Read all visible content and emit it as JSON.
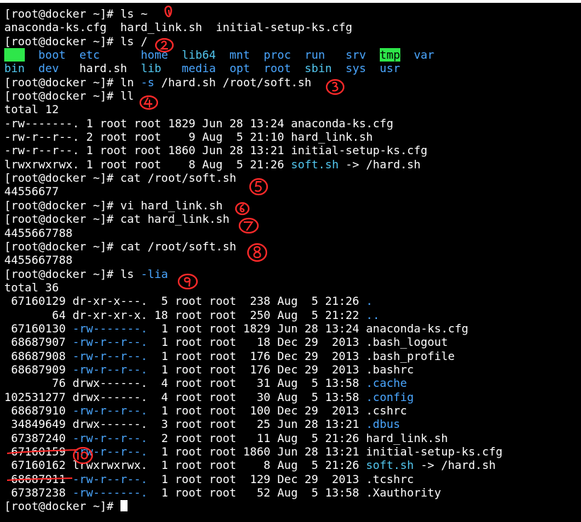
{
  "colors": {
    "fg": "#ffffff",
    "dir": "#4aa6ff",
    "link": "#52c6ee",
    "exe": "#2ee64a",
    "mark": "#ff2a2a"
  },
  "lines": [
    [
      {
        "t": "[root@docker ~]# ls ~",
        "c": "fg"
      }
    ],
    [
      {
        "t": "anaconda-ks.cfg  hard_link.sh  initial-setup-ks.cfg",
        "c": "fg"
      }
    ],
    [
      {
        "t": "[root@docker ~]# ls /",
        "c": "fg"
      }
    ],
    [
      {
        "t": "bin",
        "c": "hl-bin"
      },
      {
        "t": "  ",
        "c": "fg"
      },
      {
        "t": "boot",
        "c": "dir"
      },
      {
        "t": "  ",
        "c": "fg"
      },
      {
        "t": "etc",
        "c": "dir"
      },
      {
        "t": "      ",
        "c": "fg"
      },
      {
        "t": "home",
        "c": "dir"
      },
      {
        "t": "  ",
        "c": "fg"
      },
      {
        "t": "lib64",
        "c": "link"
      },
      {
        "t": "  ",
        "c": "fg"
      },
      {
        "t": "mnt",
        "c": "dir"
      },
      {
        "t": "  ",
        "c": "fg"
      },
      {
        "t": "proc",
        "c": "dir"
      },
      {
        "t": "  ",
        "c": "fg"
      },
      {
        "t": "run",
        "c": "dir"
      },
      {
        "t": "   ",
        "c": "fg"
      },
      {
        "t": "srv",
        "c": "dir"
      },
      {
        "t": "  ",
        "c": "fg"
      },
      {
        "t": "tmp",
        "c": "hl-tmp"
      },
      {
        "t": "  ",
        "c": "fg"
      },
      {
        "t": "var",
        "c": "dir"
      }
    ],
    [
      {
        "t": "bin",
        "c": "link"
      },
      {
        "t": "  ",
        "c": "fg"
      },
      {
        "t": "dev",
        "c": "dir"
      },
      {
        "t": "   ",
        "c": "fg"
      },
      {
        "t": "hard.sh",
        "c": "fg"
      },
      {
        "t": "  ",
        "c": "fg"
      },
      {
        "t": "lib",
        "c": "link"
      },
      {
        "t": "   ",
        "c": "fg"
      },
      {
        "t": "media",
        "c": "dir"
      },
      {
        "t": "  ",
        "c": "fg"
      },
      {
        "t": "opt",
        "c": "dir"
      },
      {
        "t": "  ",
        "c": "fg"
      },
      {
        "t": "root",
        "c": "dir"
      },
      {
        "t": "  ",
        "c": "fg"
      },
      {
        "t": "sbin",
        "c": "link"
      },
      {
        "t": "  ",
        "c": "fg"
      },
      {
        "t": "sys",
        "c": "dir"
      },
      {
        "t": "  ",
        "c": "fg"
      },
      {
        "t": "usr",
        "c": "dir"
      }
    ],
    [
      {
        "t": "[root@docker ~]# ln ",
        "c": "fg"
      },
      {
        "t": "-s",
        "c": "dir"
      },
      {
        "t": " /hard.sh /root/soft.sh",
        "c": "fg"
      }
    ],
    [
      {
        "t": "[root@docker ~]# ll",
        "c": "fg"
      }
    ],
    [
      {
        "t": "total 12",
        "c": "fg"
      }
    ],
    [
      {
        "t": "-rw-------. 1 root root 1829 Jun 28 13:24 anaconda-ks.cfg",
        "c": "fg"
      }
    ],
    [
      {
        "t": "-rw-r--r--. 2 root root    9 Aug  5 21:10 hard_link.sh",
        "c": "fg"
      }
    ],
    [
      {
        "t": "-rw-r--r--. 1 root root 1860 Jun 28 13:21 initial-setup-ks.cfg",
        "c": "fg"
      }
    ],
    [
      {
        "t": "lrwxrwxrwx. 1 root root    8 Aug  5 21:26 ",
        "c": "fg"
      },
      {
        "t": "soft.sh",
        "c": "link"
      },
      {
        "t": " -> /hard.sh",
        "c": "fg"
      }
    ],
    [
      {
        "t": "[root@docker ~]# cat /root/soft.sh",
        "c": "fg"
      }
    ],
    [
      {
        "t": "44556677",
        "c": "fg"
      }
    ],
    [
      {
        "t": "[root@docker ~]# vi hard_link.sh",
        "c": "fg"
      }
    ],
    [
      {
        "t": "[root@docker ~]# cat hard_link.sh",
        "c": "fg"
      }
    ],
    [
      {
        "t": "4455667788",
        "c": "fg"
      }
    ],
    [
      {
        "t": "[root@docker ~]# cat /root/soft.sh",
        "c": "fg"
      }
    ],
    [
      {
        "t": "4455667788",
        "c": "fg"
      }
    ],
    [
      {
        "t": "[root@docker ~]# ls ",
        "c": "fg"
      },
      {
        "t": "-lia",
        "c": "dir"
      }
    ],
    [
      {
        "t": "total 36",
        "c": "fg"
      }
    ],
    [
      {
        "t": " 67160129 dr-xr-x---.  5 root root  238 Aug  5 21:26 ",
        "c": "fg"
      },
      {
        "t": ".",
        "c": "dir"
      }
    ],
    [
      {
        "t": "       64 dr-xr-xr-x. 18 root root  250 Aug  5 21:22 ",
        "c": "fg"
      },
      {
        "t": "..",
        "c": "dir"
      }
    ],
    [
      {
        "t": " 67160130 ",
        "c": "fg"
      },
      {
        "t": "-rw-------.",
        "c": "dir"
      },
      {
        "t": "  1 root root 1829 Jun 28 13:24 anaconda-ks.cfg",
        "c": "fg"
      }
    ],
    [
      {
        "t": " 68687907 ",
        "c": "fg"
      },
      {
        "t": "-rw-r--r--.",
        "c": "dir"
      },
      {
        "t": "  1 root root   18 Dec 29  2013 .bash_logout",
        "c": "fg"
      }
    ],
    [
      {
        "t": " 68687908 ",
        "c": "fg"
      },
      {
        "t": "-rw-r--r--.",
        "c": "dir"
      },
      {
        "t": "  1 root root  176 Dec 29  2013 .bash_profile",
        "c": "fg"
      }
    ],
    [
      {
        "t": " 68687909 ",
        "c": "fg"
      },
      {
        "t": "-rw-r--r--.",
        "c": "dir"
      },
      {
        "t": "  1 root root  176 Dec 29  2013 .bashrc",
        "c": "fg"
      }
    ],
    [
      {
        "t": "       76 drwx------.  4 root root   31 Aug  5 13:58 ",
        "c": "fg"
      },
      {
        "t": ".cache",
        "c": "dir"
      }
    ],
    [
      {
        "t": "102531277 drwx------.  4 root root   30 Aug  5 13:58 ",
        "c": "fg"
      },
      {
        "t": ".config",
        "c": "dir"
      }
    ],
    [
      {
        "t": " 68687910 ",
        "c": "fg"
      },
      {
        "t": "-rw-r--r--.",
        "c": "dir"
      },
      {
        "t": "  1 root root  100 Dec 29  2013 .cshrc",
        "c": "fg"
      }
    ],
    [
      {
        "t": " 34849649 drwx------.  3 root root   25 Jun 28 13:21 ",
        "c": "fg"
      },
      {
        "t": ".dbus",
        "c": "dir"
      }
    ],
    [
      {
        "t": " 67387240 ",
        "c": "fg"
      },
      {
        "t": "-rw-r--r--.",
        "c": "dir"
      },
      {
        "t": "  2 root root   11 Aug  5 21:26 hard_link.sh",
        "c": "fg"
      }
    ],
    [
      {
        "t": " 67160159 ",
        "c": "fg"
      },
      {
        "t": "-rw-r--r--.",
        "c": "dir"
      },
      {
        "t": "  1 root root 1860 Jun 28 13:21 initial-setup-ks.cfg",
        "c": "fg"
      }
    ],
    [
      {
        "t": " 67160162 lrwxrwxrwx.  1 root root    8 Aug  5 21:26 ",
        "c": "fg"
      },
      {
        "t": "soft.sh",
        "c": "link"
      },
      {
        "t": " -> /hard.sh",
        "c": "fg"
      }
    ],
    [
      {
        "t": " 68687911 ",
        "c": "fg"
      },
      {
        "t": "-rw-r--r--.",
        "c": "dir"
      },
      {
        "t": "  1 root root  129 Dec 29  2013 .tcshrc",
        "c": "fg"
      }
    ],
    [
      {
        "t": " 67387238 ",
        "c": "fg"
      },
      {
        "t": "-rw-------.",
        "c": "dir"
      },
      {
        "t": "  1 root root   52 Aug  5 13:58 .Xauthority",
        "c": "fg"
      }
    ],
    [
      {
        "t": "[root@docker ~]# ",
        "c": "fg"
      },
      {
        "t": "",
        "c": "cursor"
      }
    ]
  ],
  "annotations": [
    "1",
    "2",
    "3",
    "4",
    "5",
    "6",
    "7",
    "8",
    "9",
    "10"
  ]
}
